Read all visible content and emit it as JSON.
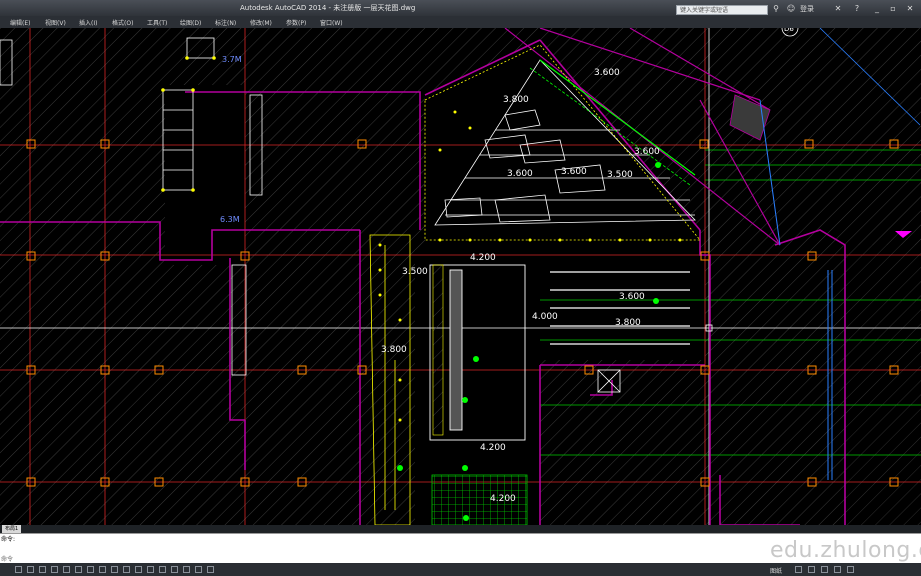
{
  "window": {
    "title": "Autodesk AutoCAD 2014 - 未注册版    一层天花图.dwg",
    "search_placeholder": "键入关键字或短语",
    "login_label": "登录"
  },
  "menu": {
    "items": [
      "编辑(E)",
      "视图(V)",
      "插入(I)",
      "格式(O)",
      "工具(T)",
      "绘图(D)",
      "标注(N)",
      "修改(M)",
      "参数(P)",
      "窗口(W)"
    ]
  },
  "drawing": {
    "annotations": {
      "a1": "3.7M",
      "a2": "6.3M",
      "a3": "3.600",
      "a4": "3.800",
      "a5": "3.600",
      "a6": "3.600",
      "a7": "3.600",
      "a8": "3.500",
      "a9": "4.200",
      "a10": "3.500",
      "a11": "3.600",
      "a12": "4.000",
      "a13": "3.800",
      "a14": "3.800",
      "a15": "4.200",
      "a16": "4.200",
      "a17": "D6"
    },
    "colors": {
      "wall": "#b4009e",
      "grid": "#ff2d2d",
      "hatch": "#3a3a3a",
      "ceiling": "#ffffff",
      "green": "#00ff00",
      "yellow": "#ffff00",
      "blue": "#2a7fff"
    }
  },
  "layout_tab": "布局1",
  "command": {
    "line1": "命令:",
    "line2": "命令"
  },
  "watermark": "edu.zhulong.com",
  "status": {
    "label": "图纸"
  }
}
